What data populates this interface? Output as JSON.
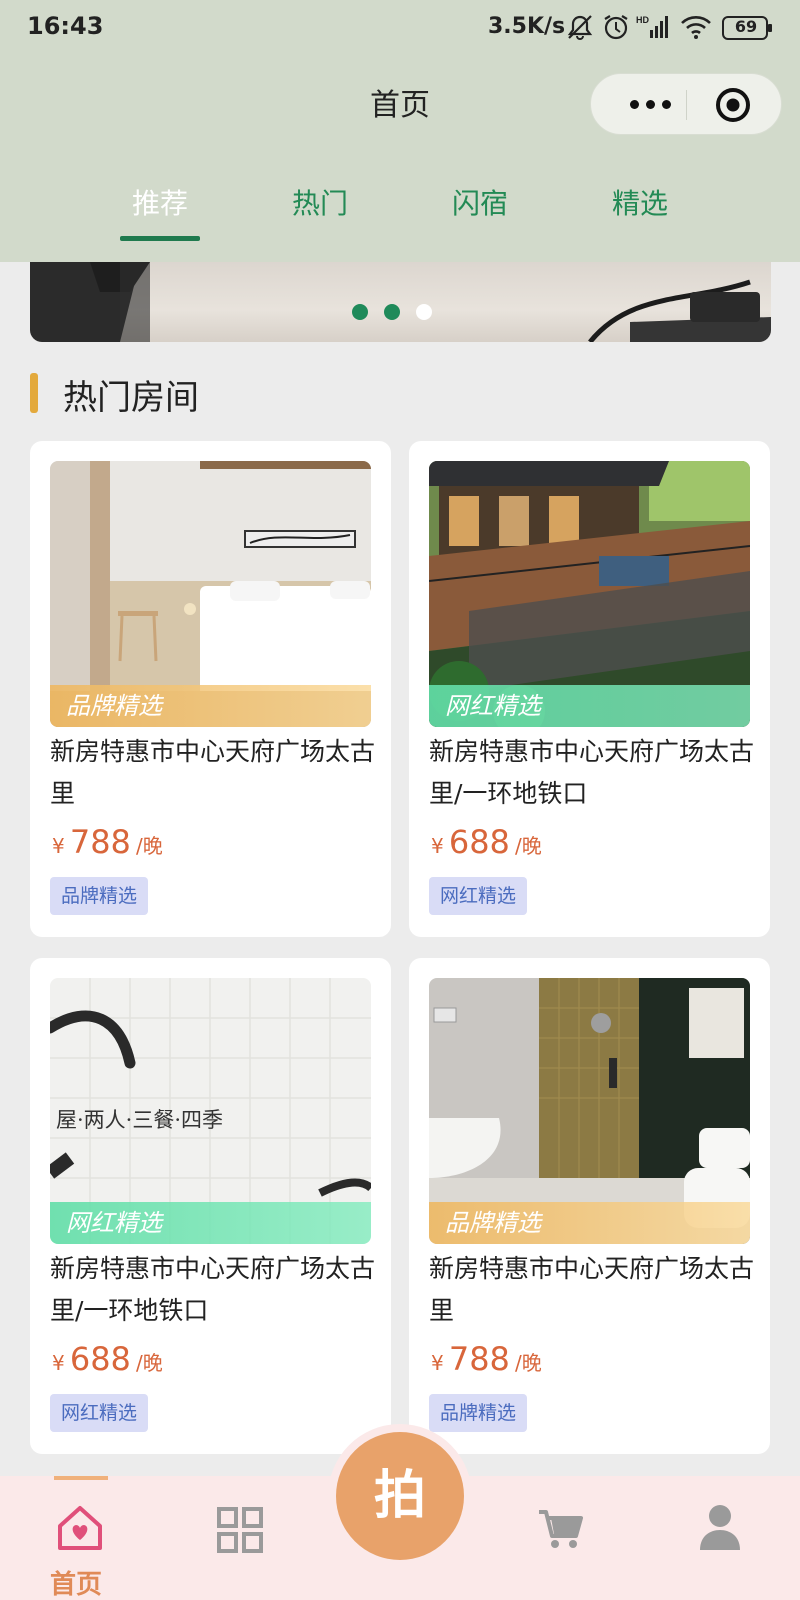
{
  "status_bar": {
    "time": "16:43",
    "network_speed": "3.5K/s",
    "battery": "69"
  },
  "navbar": {
    "title": "首页"
  },
  "tabs": [
    {
      "label": "推荐",
      "active": true
    },
    {
      "label": "热门",
      "active": false
    },
    {
      "label": "闪宿",
      "active": false
    },
    {
      "label": "精选",
      "active": false
    }
  ],
  "banner": {
    "slide_count": 3,
    "active_index": 2
  },
  "section": {
    "title": "热门房间"
  },
  "cards": [
    {
      "ribbon": "品牌精选",
      "title": "新房特惠市中心天府广场太古里",
      "currency": "¥",
      "price": "788",
      "unit": "/晚",
      "tag": "品牌精选"
    },
    {
      "ribbon": "网红精选",
      "title": "新房特惠市中心天府广场太古里/一环地铁口",
      "currency": "¥",
      "price": "688",
      "unit": "/晚",
      "tag": "网红精选"
    },
    {
      "ribbon": "网红精选",
      "title": "新房特惠市中心天府广场太古里/一环地铁口",
      "currency": "¥",
      "price": "688",
      "unit": "/晚",
      "tag": "网红精选",
      "image_text": "屋·两人·三餐·四季"
    },
    {
      "ribbon": "品牌精选",
      "title": "新房特惠市中心天府广场太古里",
      "currency": "¥",
      "price": "788",
      "unit": "/晚",
      "tag": "品牌精选"
    }
  ],
  "tabbar": {
    "home_label": "首页",
    "shoot_label": "拍",
    "icons": [
      "home-heart-icon",
      "grid-icon",
      "cart-icon",
      "user-icon"
    ]
  },
  "colors": {
    "accent_green": "#238a55",
    "price": "#d8663b",
    "tag_text": "#4b6cbf",
    "shoot": "#e8a26a"
  }
}
